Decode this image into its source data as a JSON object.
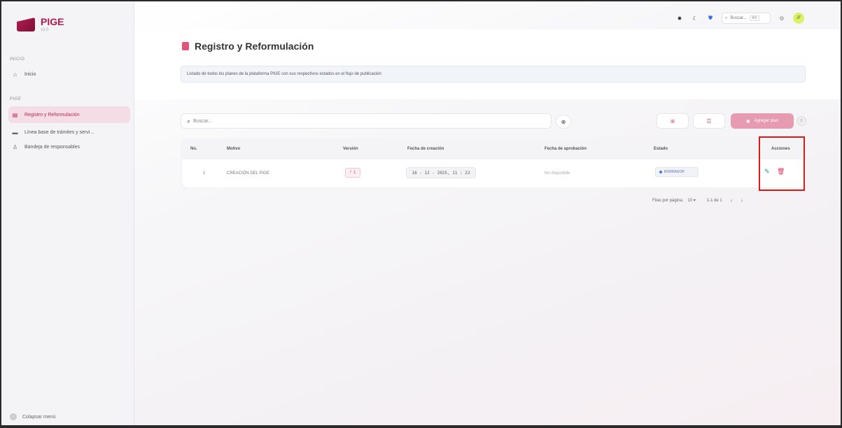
{
  "app": {
    "logo_title": "PIGE",
    "logo_sub": "v3.0"
  },
  "sidebar": {
    "section_inicio": "INICIO",
    "item_inicio": "Inicio",
    "section_pige": "PIGE",
    "items": [
      {
        "label": "Registro y Reformulación",
        "icon": "document-icon",
        "active": true
      },
      {
        "label": "Línea base de trámites y servi...",
        "icon": "briefcase-icon",
        "active": false
      },
      {
        "label": "Bandeja de responsables",
        "icon": "users-icon",
        "active": false
      }
    ],
    "collapse_label": "Colapsar menú"
  },
  "topbar": {
    "search_placeholder": "Buscar...",
    "search_shortcut": "⌘K",
    "avatar_initials": "JF"
  },
  "page": {
    "title": "Registro y Reformulación",
    "description": "Listado de todos los planes de la plataforma PIGE con sus respectivos estados en el flujo de publicación"
  },
  "toolbar": {
    "search_placeholder": "Buscar...",
    "add_button": "Agregar plan"
  },
  "table": {
    "headers": [
      "No.",
      "Motivo",
      "Versión",
      "Fecha de creación",
      "Fecha de aprobación",
      "Estado",
      "Acciones"
    ],
    "rows": [
      {
        "no": "1",
        "motivo": "CREACIÓN DEL PIGE",
        "version": "1",
        "fecha_creacion": "16 - 12 - 2025, 11 : 22",
        "fecha_aprobacion": "No disponible",
        "estado": "BORRADOR"
      }
    ]
  },
  "pagination": {
    "rows_per_page_label": "Filas por página:",
    "rows_per_page_value": "10",
    "range": "1-1 de 1"
  },
  "colors": {
    "brand": "#b01b4a",
    "accent_pink": "#e79bb3",
    "highlight": "#e01818",
    "edit": "#1f9c6b",
    "delete": "#e0345e"
  }
}
